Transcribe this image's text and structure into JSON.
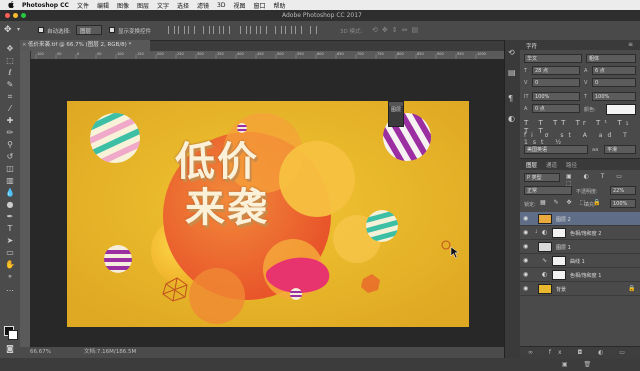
{
  "menubar": {
    "apple": "",
    "app_name": "Photoshop CC",
    "items": [
      "文件",
      "编辑",
      "图像",
      "图层",
      "文字",
      "选择",
      "滤镜",
      "3D",
      "视图",
      "窗口",
      "帮助"
    ]
  },
  "window": {
    "title": "Adobe Photoshop CC 2017"
  },
  "options_bar": {
    "auto_select_label": "自动选择:",
    "auto_select_value": "图层",
    "show_transform_label": "显示变换控件",
    "mode_3d_label": "3D 模式:"
  },
  "document": {
    "tab_title": "低价来袭.tif @ 66.7% (图层 2, RGB/8) *",
    "zoom": "66.67%",
    "doc_info": "文档:7.16M/186.5M",
    "artwork_line1": "低价",
    "artwork_line2": "来袭",
    "float_label": "图层"
  },
  "ruler": {
    "ticks": [
      "100",
      "50",
      "0",
      "50",
      "100",
      "150",
      "200",
      "250",
      "300",
      "350",
      "400",
      "450",
      "500",
      "550",
      "600",
      "650",
      "700",
      "750",
      "800",
      "850",
      "900",
      "950",
      "1000"
    ]
  },
  "character_panel": {
    "tab": "字符",
    "font_family": "华文",
    "font_style": "粗体",
    "font_size": "28 点",
    "leading": "6 点",
    "kerning": "0",
    "tracking": "0",
    "scale_v": "100%",
    "scale_h": "100%",
    "baseline": "0 点",
    "color_label": "颜色:",
    "language": "美国英语",
    "anti_alias": "平滑"
  },
  "layers_panel": {
    "tabs": [
      "图层",
      "通道",
      "路径"
    ],
    "filter_kind": "P 类型",
    "blend_mode": "正常",
    "opacity_label": "不透明度:",
    "opacity": "22%",
    "lock_label": "锁定:",
    "fill_label": "填充:",
    "fill": "100%",
    "layers": [
      {
        "name": "图层 2",
        "selected": true,
        "thumb": "#e9a93c"
      },
      {
        "name": "色相/饱和度 2",
        "selected": false,
        "thumb": "#f2f2f2"
      },
      {
        "name": "图层 1",
        "selected": false,
        "thumb": "#d8d8d8"
      },
      {
        "name": "曲线 1",
        "selected": false,
        "thumb": "#f2f2f2"
      },
      {
        "name": "色相/饱和度 1",
        "selected": false,
        "thumb": "#f2f2f2"
      },
      {
        "name": "背景",
        "selected": false,
        "thumb": "#e8b92f"
      }
    ]
  },
  "colors": {
    "bg_yellow": "#e8b92f",
    "orange_blob": "#f06a2c",
    "pink_blob": "#e8346e",
    "text_cream": "#fbf0d8"
  }
}
